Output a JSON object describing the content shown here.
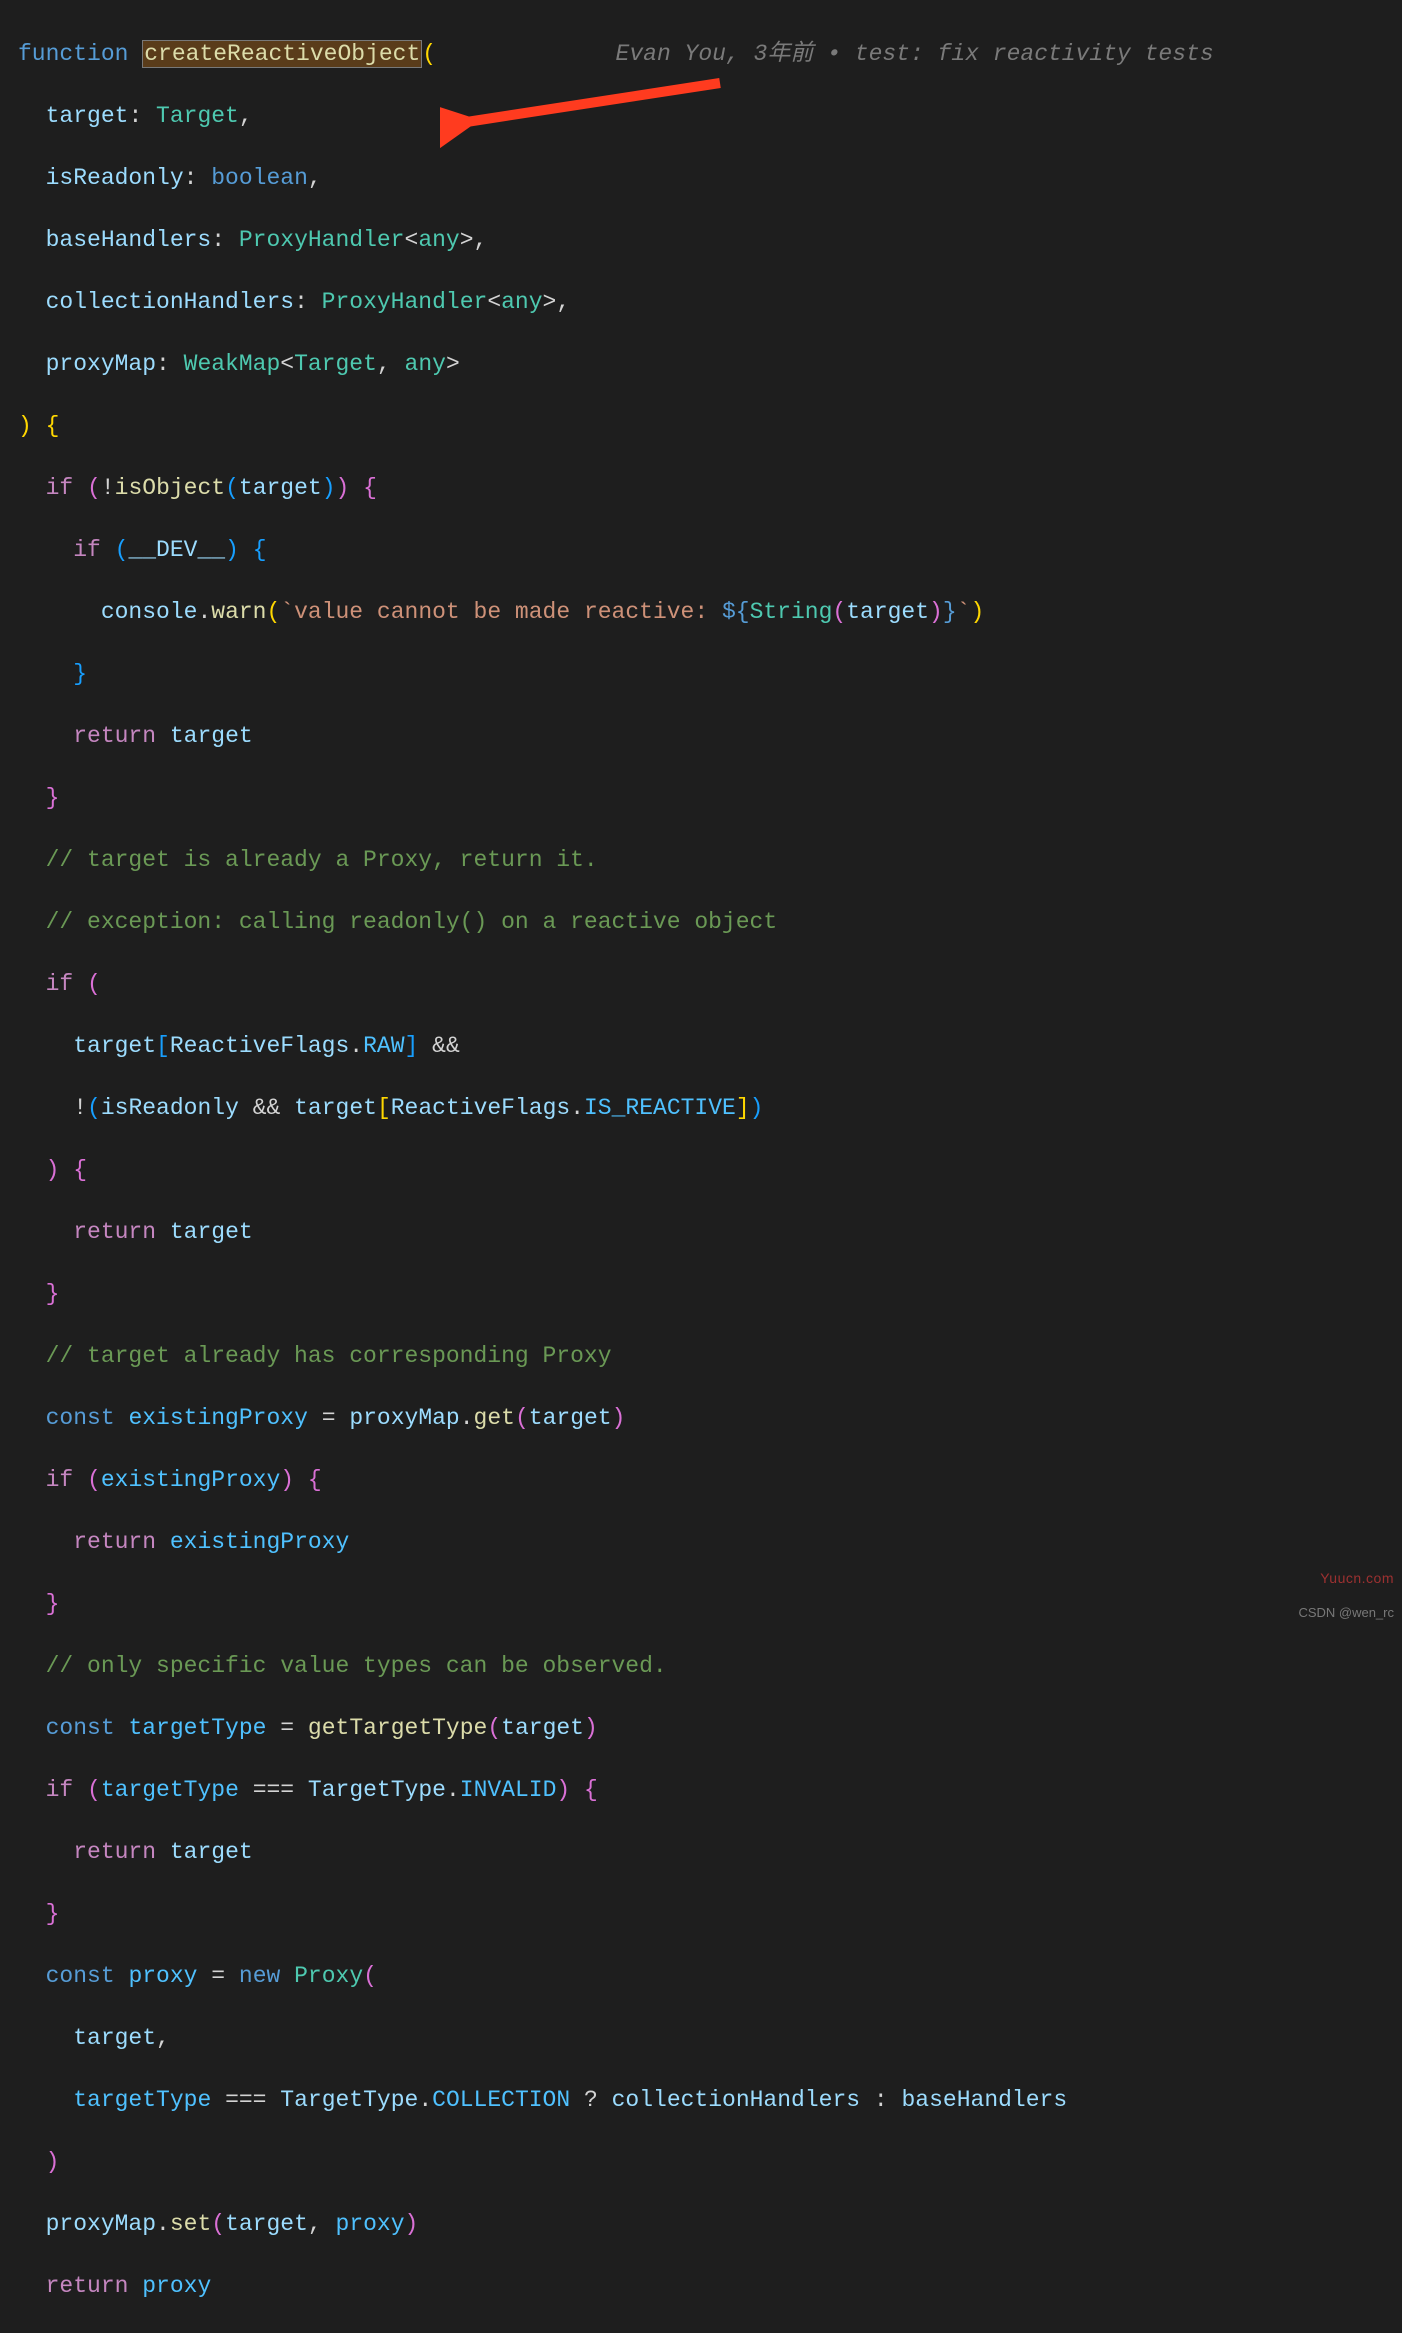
{
  "gitlens": "Evan You, 3年前 • test: fix reactivity tests",
  "watermark1": "Yuucn.com",
  "watermark2": "CSDN @wen_rc",
  "code": {
    "fn_kw": "function",
    "fn_name": "createReactiveObject",
    "p1_name": "target",
    "p1_type": "Target",
    "p2_name": "isReadonly",
    "p2_type": "boolean",
    "p3_name": "baseHandlers",
    "p3_type": "ProxyHandler",
    "p3_gen": "any",
    "p4_name": "collectionHandlers",
    "p4_type": "ProxyHandler",
    "p4_gen": "any",
    "p5_name": "proxyMap",
    "p5_type": "WeakMap",
    "p5_g1": "Target",
    "p5_g2": "any",
    "if": "if",
    "return": "return",
    "const": "const",
    "new": "new",
    "isObject": "isObject",
    "dev": "__DEV__",
    "console": "console",
    "warn": "warn",
    "str1": "`value cannot be made reactive: ",
    "String": "String",
    "str_end": "`",
    "target": "target",
    "cmt1": "// target is already a Proxy, return it.",
    "cmt2": "// exception: calling readonly() on a reactive object",
    "ReactiveFlags": "ReactiveFlags",
    "RAW": "RAW",
    "IS_REACTIVE": "IS_REACTIVE",
    "and": "&&",
    "not": "!",
    "cmt3": "// target already has corresponding Proxy",
    "existingProxy": "existingProxy",
    "proxyMap": "proxyMap",
    "get": "get",
    "cmt4": "// only specific value types can be observed.",
    "targetType": "targetType",
    "getTargetType": "getTargetType",
    "eq3": "===",
    "TargetType": "TargetType",
    "INVALID": "INVALID",
    "proxy": "proxy",
    "Proxy": "Proxy",
    "COLLECTION": "COLLECTION",
    "q": "?",
    "colon": ":",
    "collectionHandlers": "collectionHandlers",
    "baseHandlers": "baseHandlers",
    "set": "set"
  }
}
